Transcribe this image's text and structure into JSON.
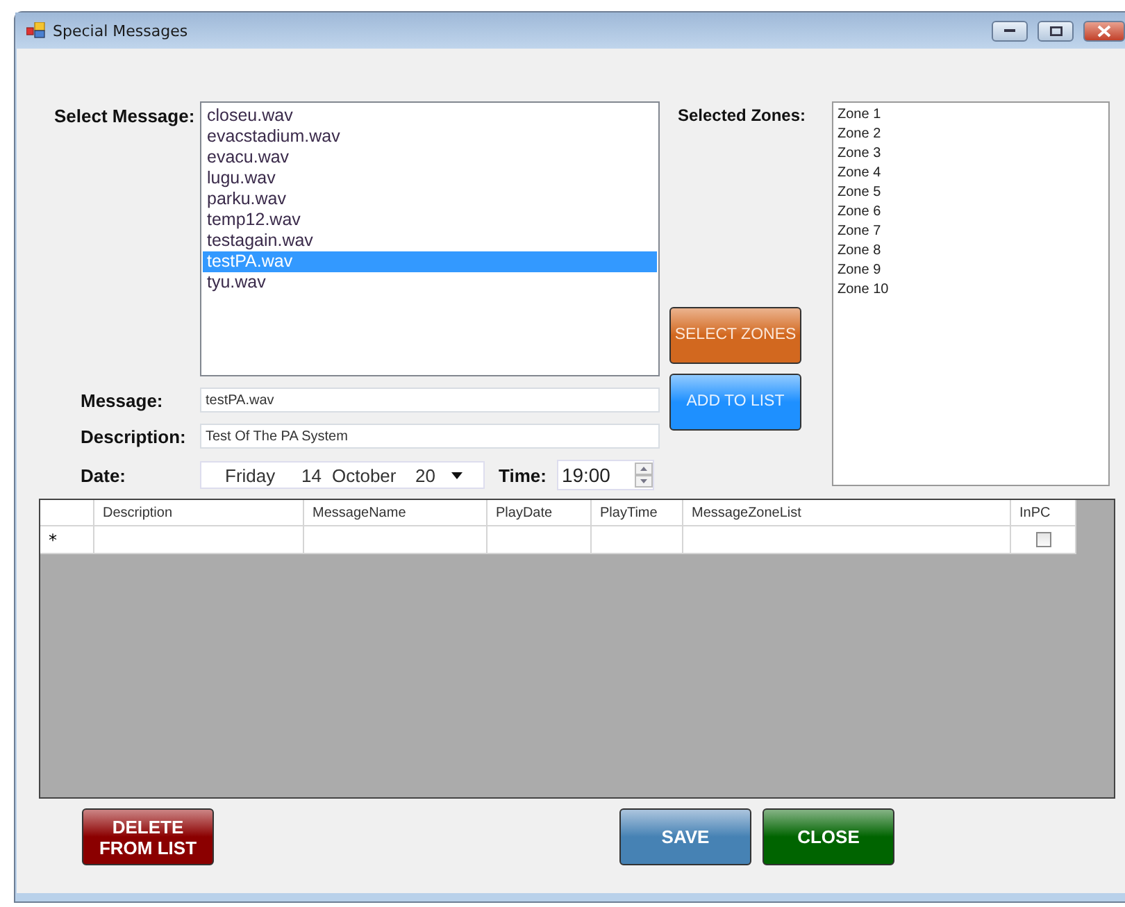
{
  "window": {
    "title": "Special Messages"
  },
  "message_list": {
    "label": "Select Message:",
    "items": [
      {
        "name": "closeu.wav",
        "selected": false
      },
      {
        "name": "evacstadium.wav",
        "selected": false
      },
      {
        "name": "evacu.wav",
        "selected": false
      },
      {
        "name": "lugu.wav",
        "selected": false
      },
      {
        "name": "parku.wav",
        "selected": false
      },
      {
        "name": "temp12.wav",
        "selected": false
      },
      {
        "name": "testagain.wav",
        "selected": false
      },
      {
        "name": "testPA.wav",
        "selected": true
      },
      {
        "name": "tyu.wav",
        "selected": false
      }
    ]
  },
  "zone_buttons": [
    {
      "label": "SELECT ZONES",
      "kind": "orange"
    },
    {
      "label": "ADD TO LIST",
      "kind": "blue"
    }
  ],
  "zones": {
    "label": "Selected Zones:",
    "items": [
      "Zone 1",
      "Zone 2",
      "Zone 3",
      "Zone 4",
      "Zone 5",
      "Zone 6",
      "Zone 7",
      "Zone 8",
      "Zone 9",
      "Zone 10"
    ]
  },
  "message": {
    "label": "Message:",
    "value": "testPA.wav"
  },
  "description": {
    "label": "Description:",
    "value": "Test Of The PA System"
  },
  "date": {
    "label": "Date:",
    "day_name": "Friday",
    "day": "14",
    "month": "October",
    "year": "20"
  },
  "time": {
    "label": "Time:",
    "value": "19:00"
  },
  "grid": {
    "columns": [
      "Description",
      "MessageName",
      "PlayDate",
      "PlayTime",
      "MessageZoneList",
      "InPC"
    ],
    "new_row": {
      "marker": "*",
      "inpc_checked": false
    }
  },
  "actions": [
    {
      "label": "DELETE\nFROM LIST",
      "kind": "red"
    },
    {
      "label": "SAVE",
      "kind": "steel"
    },
    {
      "label": "CLOSE",
      "kind": "green"
    }
  ]
}
